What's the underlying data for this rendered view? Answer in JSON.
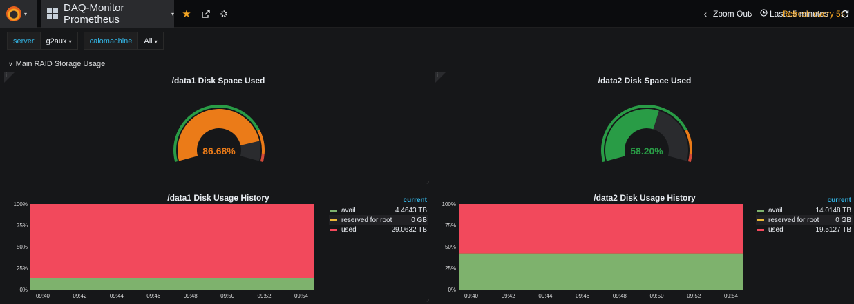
{
  "topbar": {
    "dashboard_title": "DAQ-Monitor Prometheus",
    "zoom_out": "Zoom Out",
    "time_range": "Last 15 minutes",
    "refresh": "Refresh every 5s"
  },
  "variables": [
    {
      "label": "server",
      "value": "g2aux"
    },
    {
      "label": "calomachine",
      "value": "All"
    }
  ],
  "row": {
    "title": "Main RAID Storage Usage"
  },
  "gauges": [
    {
      "title": "/data1 Disk Space Used",
      "value_text": "86.68%",
      "value": 86.68,
      "color": "#eb7b18"
    },
    {
      "title": "/data2 Disk Space Used",
      "value_text": "58.20%",
      "value": 58.2,
      "color": "#299c46"
    }
  ],
  "histories": [
    {
      "title": "/data1 Disk Usage History",
      "legend_header": "current",
      "legend": [
        {
          "name": "avail",
          "value": "4.4643 TB",
          "color": "#7eb26d"
        },
        {
          "name": "reserved for root",
          "value": "0 GB",
          "color": "#eab839"
        },
        {
          "name": "used",
          "value": "29.0632 TB",
          "color": "#f2495c"
        }
      ],
      "yticks": [
        "100%",
        "75%",
        "50%",
        "25%",
        "0%"
      ],
      "xticks": [
        "09:40",
        "09:42",
        "09:44",
        "09:46",
        "09:48",
        "09:50",
        "09:52",
        "09:54"
      ],
      "avail_pct": 13.3
    },
    {
      "title": "/data2 Disk Usage History",
      "legend_header": "current",
      "legend": [
        {
          "name": "avail",
          "value": "14.0148 TB",
          "color": "#7eb26d"
        },
        {
          "name": "reserved for root",
          "value": "0 GB",
          "color": "#eab839"
        },
        {
          "name": "used",
          "value": "19.5127 TB",
          "color": "#f2495c"
        }
      ],
      "yticks": [
        "100%",
        "75%",
        "50%",
        "25%",
        "0%"
      ],
      "xticks": [
        "09:40",
        "09:42",
        "09:44",
        "09:46",
        "09:48",
        "09:50",
        "09:52",
        "09:54"
      ],
      "avail_pct": 41.8
    }
  ],
  "colors": {
    "accent": "#33b5e5",
    "refresh": "#f5a623",
    "used": "#f2495c",
    "avail": "#7eb26d",
    "reserved": "#eab839"
  }
}
